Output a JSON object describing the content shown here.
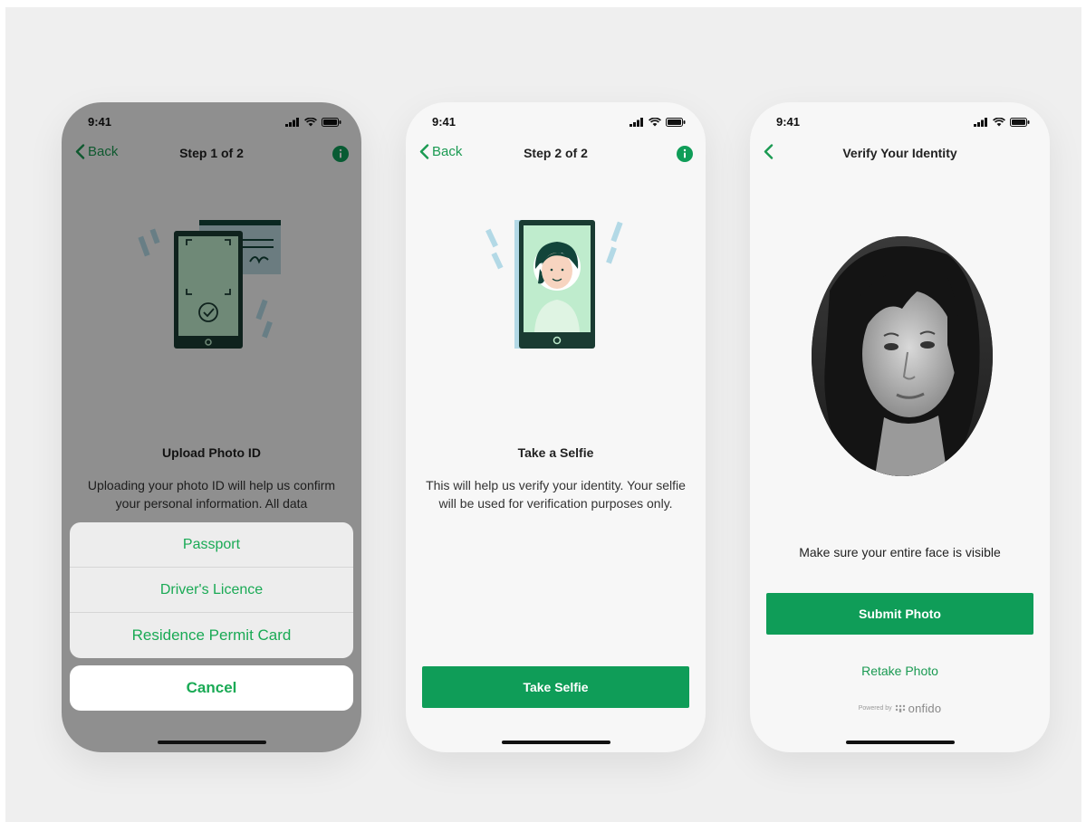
{
  "colors": {
    "brand_green": "#0f9d58",
    "link_green": "#1a9a52",
    "background": "#efefef"
  },
  "screens": [
    {
      "status_time": "9:41",
      "nav": {
        "back_label": "Back",
        "title": "Step 1 of 2",
        "info_icon": "info-icon"
      },
      "content": {
        "title": "Upload Photo ID",
        "body": "Uploading your photo ID will help us confirm your personal information. All data"
      },
      "action_sheet": {
        "options": [
          "Passport",
          "Driver's Licence",
          "Residence Permit Card"
        ],
        "cancel_label": "Cancel"
      }
    },
    {
      "status_time": "9:41",
      "nav": {
        "back_label": "Back",
        "title": "Step 2 of 2",
        "info_icon": "info-icon"
      },
      "content": {
        "title": "Take a Selfie",
        "body": "This will help us verify your identity. Your selfie will be used for verification purposes only."
      },
      "primary_button": "Take Selfie"
    },
    {
      "status_time": "9:41",
      "nav": {
        "title": "Verify Your Identity"
      },
      "content": {
        "hint": "Make sure your entire face is visible"
      },
      "primary_button": "Submit Photo",
      "secondary_button": "Retake Photo",
      "powered_by": {
        "prefix": "Powered by",
        "brand": "onfido"
      }
    }
  ]
}
